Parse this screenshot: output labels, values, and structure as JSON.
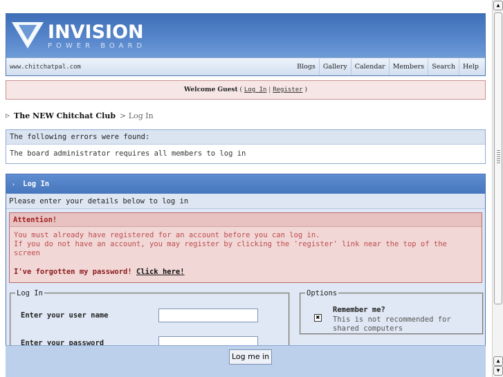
{
  "header": {
    "logo_title": "INVISION",
    "logo_subtitle": "POWER BOARD",
    "site_url": "www.chitchatpal.com",
    "nav": [
      "Blogs",
      "Gallery",
      "Calendar",
      "Members",
      "Search",
      "Help"
    ]
  },
  "welcome": {
    "prefix": "Welcome Guest",
    "open": "(",
    "login": "Log In",
    "sep": "|",
    "register": "Register",
    "close": ")"
  },
  "breadcrumb": {
    "arrow": "▷",
    "home": "The NEW Chitchat Club",
    "rest": "> Log In"
  },
  "errors": {
    "title": "The following errors were found:",
    "message": "The board administrator requires all members to log in"
  },
  "login": {
    "heading_arrow": "›",
    "heading": "Log In",
    "subheading": "Please enter your details below to log in",
    "attention_title": "Attention!",
    "attention_line1": "You must already have registered for an account before you can log in.",
    "attention_line2": "If you do not have an account, you may register by clicking the 'register' link near the top of the screen",
    "forgot_text": "I've forgotten my password!",
    "forgot_link": "Click here!",
    "fieldset_legend": "Log In",
    "username_label": "Enter your user name",
    "password_label": "Enter your password",
    "username_value": "",
    "password_value": "",
    "options_legend": "Options",
    "remember_label": "Remember me?",
    "remember_desc": "This is not recommended for shared computers",
    "remember_checked": true,
    "remember_mark": "✖",
    "submit_label": "Log me in"
  },
  "scrollbar": {
    "up_icon": "▲",
    "down_icon": "▼"
  }
}
